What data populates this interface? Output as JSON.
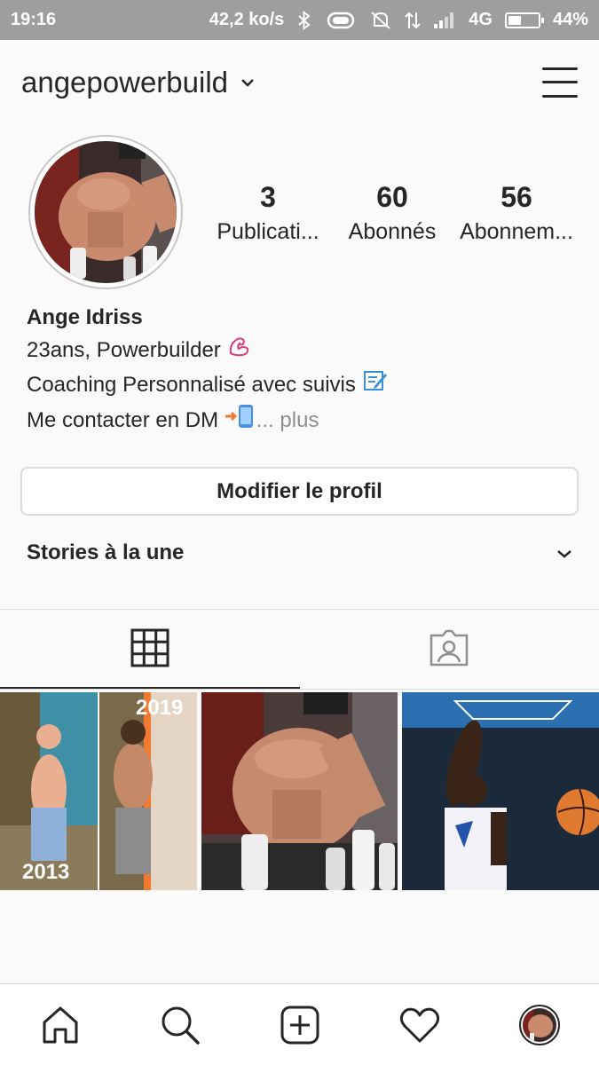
{
  "status_bar": {
    "time": "19:16",
    "net_speed": "42,2 ko/s",
    "network": "4G",
    "battery": "44%",
    "battery_level": 0.44,
    "icons": [
      "bluetooth-icon",
      "vibrate-icon",
      "mute-icon",
      "data-arrows-icon",
      "signal-icon",
      "battery-icon"
    ]
  },
  "header": {
    "username": "angepowerbuild",
    "icons": [
      "chevron-down-icon",
      "menu-icon"
    ]
  },
  "profile": {
    "stats": [
      {
        "value": "3",
        "label": "Publicati..."
      },
      {
        "value": "60",
        "label": "Abonnés"
      },
      {
        "value": "56",
        "label": "Abonnem..."
      }
    ],
    "name": "Ange Idriss",
    "bio_lines": [
      "23ans, Powerbuilder",
      "Coaching Personnalisé avec suivis",
      "Me contacter en DM "
    ],
    "bio_more": "... plus",
    "emojis": [
      "flexed-biceps-emoji",
      "memo-emoji",
      "arrow-phone-emoji"
    ]
  },
  "edit_profile_label": "Modifier le profil",
  "stories_label": "Stories à la une",
  "tabs": [
    {
      "name": "grid",
      "icon": "grid-icon",
      "active": true
    },
    {
      "name": "tagged",
      "icon": "tagged-person-icon",
      "active": false
    }
  ],
  "posts": [
    {
      "caption_overlay": [
        "2019",
        "2013"
      ]
    },
    {
      "caption_overlay": []
    },
    {
      "caption_overlay": []
    }
  ],
  "bottom_nav": {
    "icons": [
      "home-icon",
      "search-icon",
      "add-post-icon",
      "heart-icon",
      "profile-avatar"
    ]
  },
  "colors": {
    "text": "#262626",
    "muted": "#8e8e8e",
    "border": "#dbdbdb",
    "status_bar": "#9e9e9e"
  }
}
